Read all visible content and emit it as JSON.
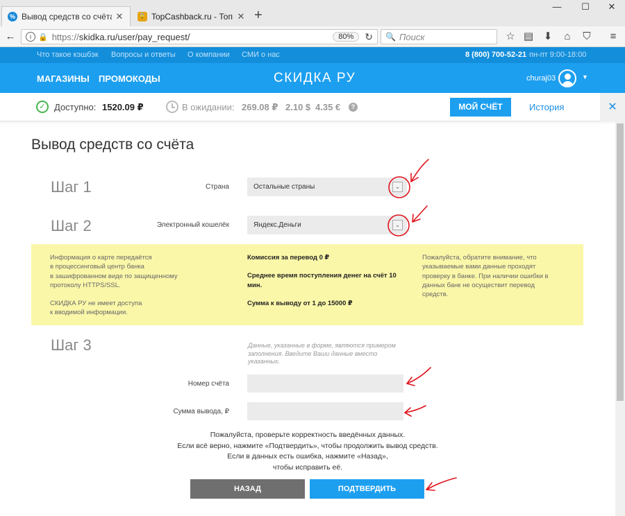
{
  "browser": {
    "tabs": [
      {
        "title": "Вывод средств со счёта | С",
        "active": true,
        "favicon": "percent-icon",
        "favicon_color": "#1a88d8"
      },
      {
        "title": "TopCashback.ru - Топ лучш",
        "active": false,
        "favicon": "lock-icon",
        "favicon_color": "#e8a316"
      }
    ],
    "new_tab_symbol": "+",
    "window_controls": [
      "—",
      "☐",
      "✕"
    ],
    "url_prefix": "https://",
    "url": "skidka.ru/user/pay_request/",
    "zoom": "80%",
    "search_placeholder": "Поиск"
  },
  "site": {
    "top_links": [
      "Что такое кэшбэк",
      "Вопросы и ответы",
      "О компании",
      "СМИ о нас"
    ],
    "phone": "8 (800) 700-52-21",
    "hours": "пн-пт 9:00-18:00",
    "nav": [
      "МАГАЗИНЫ",
      "ПРОМОКОДЫ"
    ],
    "logo": "СКИДКА РУ",
    "username": "churaj03",
    "brand_color": "#1d9ff0"
  },
  "balance": {
    "available_label": "Доступно:",
    "available_value": "1520.09 ₽",
    "pending_label": "В ожидании:",
    "pending_rub": "269.08 ₽",
    "pending_usd": "2.10 $",
    "pending_eur": "4.35 €",
    "help_symbol": "?",
    "my_account_button": "МОЙ СЧЁТ",
    "history_link": "История",
    "close_symbol": "✕"
  },
  "page": {
    "title": "Вывод средств со счёта",
    "step1": {
      "label": "Шаг 1",
      "field_label": "Страна",
      "value": "Остальные страны"
    },
    "step2": {
      "label": "Шаг 2",
      "field_label": "Электронный кошелёк",
      "value": "Яндекс.Деньги"
    },
    "info": {
      "left": [
        "Информация о карте передаётся",
        "в процессинговый центр банка",
        "в зашифрованном виде по защищенному",
        "протоколу HTTPS/SSL.",
        "",
        "СКИДКА РУ не имеет доступа",
        "к вводимой информации."
      ],
      "middle": [
        "Комиссия за перевод 0 ₽",
        "",
        "Среднее время поступления денег на счёт 10",
        "мин.",
        "",
        "Сумма к выводу от 1 до 15000 ₽"
      ],
      "right": [
        "Пожалуйста, обратите внимание, что",
        "указываемые вами данные проходят",
        "проверку в банке. При наличии ошибки в",
        "данных банк не осуществит перевод",
        "средств."
      ]
    },
    "step3": {
      "label": "Шаг 3",
      "hint": "Данные, указанные в форме, являются примером заполнения. Введите Ваши данные вместо указанных.",
      "account_label": "Номер счёта",
      "account_value": "",
      "amount_label": "Сумма вывода, ₽",
      "amount_value": ""
    },
    "note": [
      "Пожалуйста, проверьте корректность введённых данных.",
      "Если всё верно, нажмите «Подтвердить», чтобы продолжить вывод средств.",
      "Если в данных есть ошибка, нажмите «Назад»,",
      "чтобы исправить её."
    ],
    "back_button": "НАЗАД",
    "confirm_button": "ПОДТВЕРДИТЬ"
  },
  "annotation_color": "#e0141e"
}
